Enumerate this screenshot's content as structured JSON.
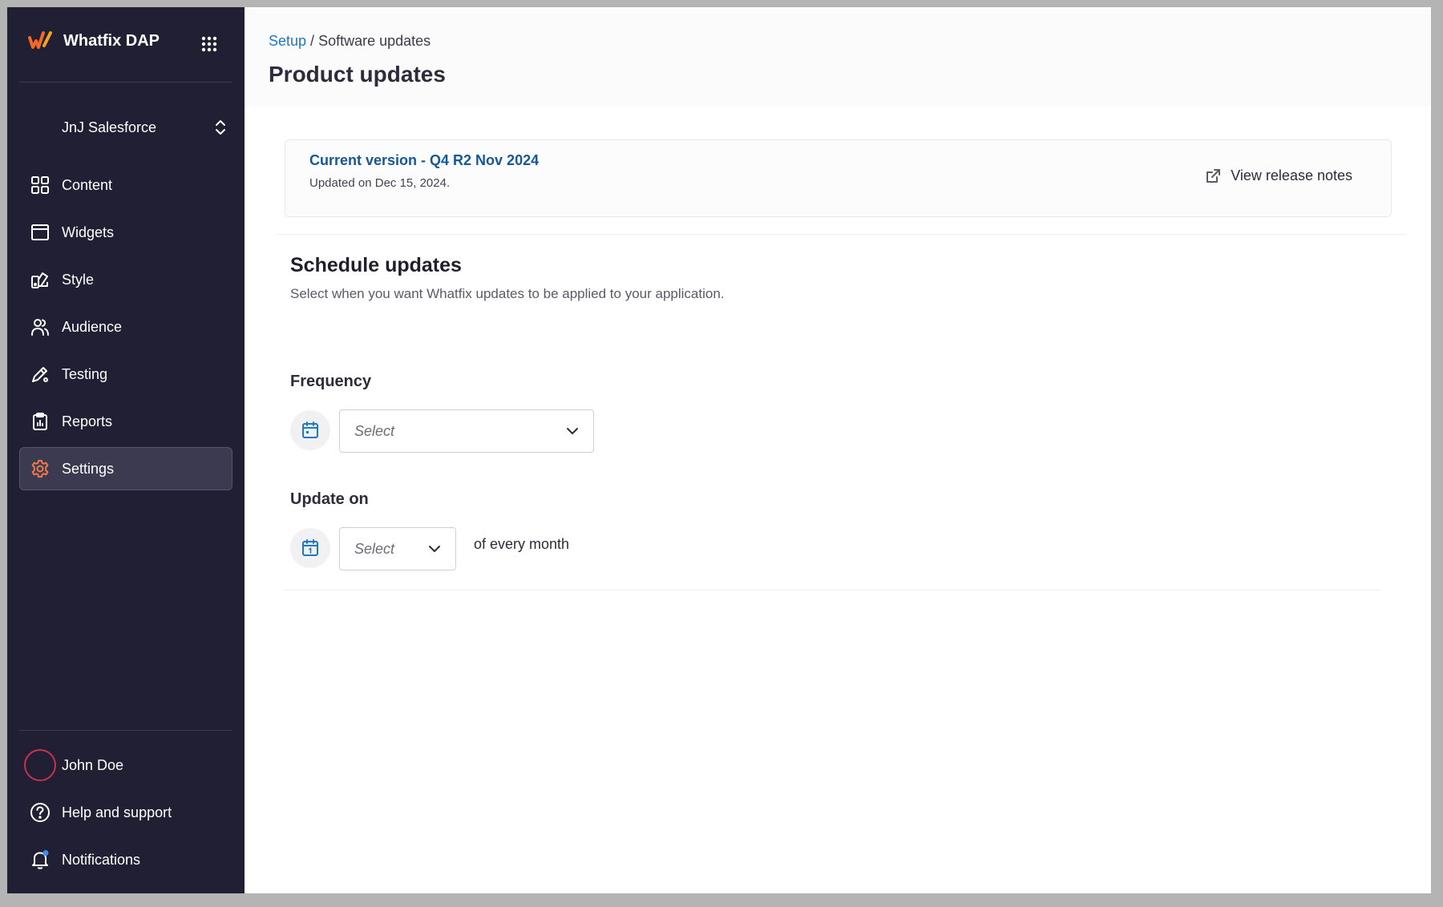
{
  "brand": {
    "name": "Whatfix DAP",
    "logo_color": "#f26a21"
  },
  "account": {
    "name": "JnJ Salesforce"
  },
  "nav": [
    {
      "label": "Content",
      "icon": "grid-icon"
    },
    {
      "label": "Widgets",
      "icon": "window-icon"
    },
    {
      "label": "Style",
      "icon": "palette-icon"
    },
    {
      "label": "Audience",
      "icon": "users-icon"
    },
    {
      "label": "Testing",
      "icon": "pen-icon"
    },
    {
      "label": "Reports",
      "icon": "clipboard-icon"
    },
    {
      "label": "Settings",
      "icon": "gear-icon",
      "active": true
    }
  ],
  "bottom_nav": [
    {
      "label": "John Doe",
      "icon": "avatar"
    },
    {
      "label": "Help and support",
      "icon": "help-icon"
    },
    {
      "label": "Notifications",
      "icon": "bell-icon"
    }
  ],
  "breadcrumb": {
    "parent": "Setup",
    "separator": " / ",
    "current": "Software updates"
  },
  "page_title": "Product updates",
  "version": {
    "title": "Current version - Q4 R2 Nov 2024",
    "updated": "Updated on Dec 15, 2024.",
    "release_notes_label": "View release notes"
  },
  "schedule": {
    "title": "Schedule updates",
    "description": "Select when you want Whatfix updates to be applied to your application.",
    "frequency": {
      "label": "Frequency",
      "placeholder": "Select"
    },
    "update_on": {
      "label": "Update on",
      "placeholder": "Select",
      "suffix": "of every month"
    }
  },
  "colors": {
    "sidebar_bg": "#201f33",
    "accent_blue": "#1f78c2",
    "settings_icon": "#f07a4a",
    "notification_dot": "#3b8df0"
  }
}
